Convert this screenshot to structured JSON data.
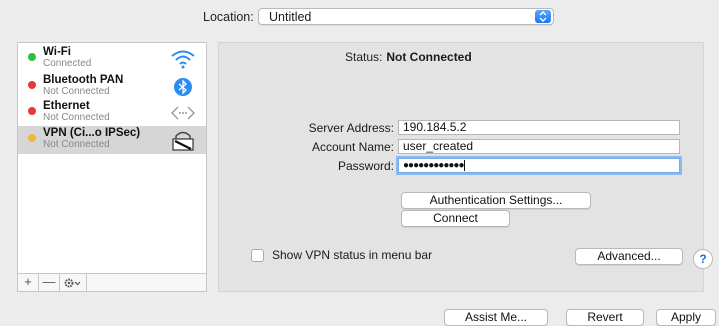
{
  "location": {
    "label": "Location:",
    "value": "Untitled"
  },
  "sidebar": {
    "services": [
      {
        "name": "Wi-Fi",
        "status": "Connected",
        "dot_color": "#2fc13c",
        "icon": "wifi-icon"
      },
      {
        "name": "Bluetooth PAN",
        "status": "Not Connected",
        "dot_color": "#e8383d",
        "icon": "bluetooth-icon"
      },
      {
        "name": "Ethernet",
        "status": "Not Connected",
        "dot_color": "#e8383d",
        "icon": "ethernet-icon"
      },
      {
        "name": "VPN (Ci...o IPSec)",
        "status": "Not Connected",
        "dot_color": "#f5b53a",
        "icon": "vpn-lock-icon",
        "selected": true
      }
    ],
    "tools": {
      "add": "+",
      "remove": "—",
      "action": "gear-icon"
    }
  },
  "detail": {
    "status_label": "Status:",
    "status_value": "Not Connected",
    "server_address_label": "Server Address:",
    "server_address_value": "190.184.5.2",
    "account_name_label": "Account Name:",
    "account_name_value": "user_created",
    "password_label": "Password:",
    "password_mask": "●●●●●●●●●●●●",
    "auth_settings_button": "Authentication Settings...",
    "connect_button": "Connect",
    "show_vpn_status_label": "Show VPN status in menu bar",
    "advanced_button": "Advanced...",
    "help_button": "?"
  },
  "footer": {
    "assist_button": "Assist Me...",
    "revert_button": "Revert",
    "apply_button": "Apply"
  },
  "colors": {
    "accent": "#1f76f0",
    "connected": "#2fc13c",
    "disconnected": "#e8383d",
    "vpn": "#f5b53a"
  }
}
